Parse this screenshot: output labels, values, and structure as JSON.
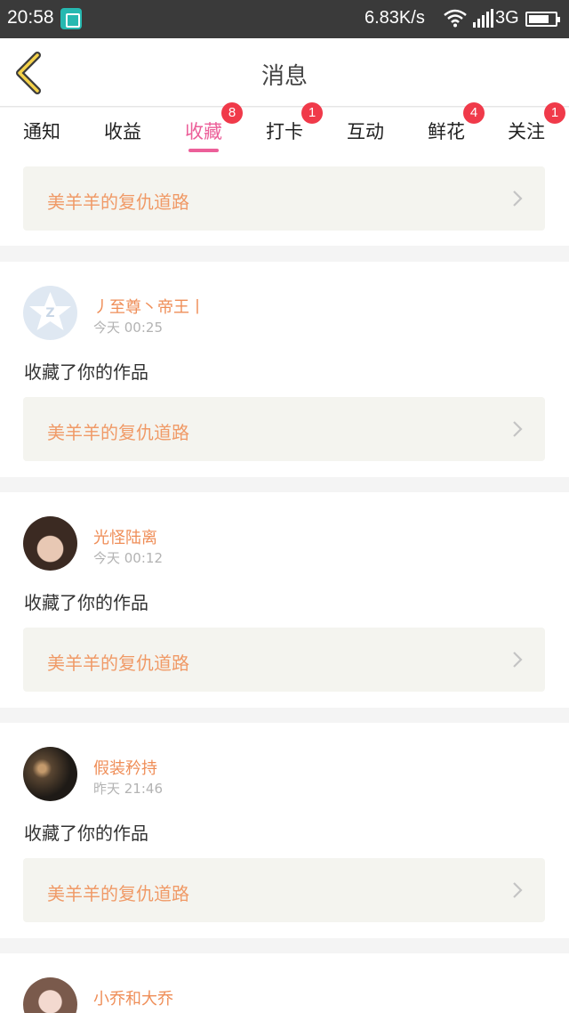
{
  "status_bar": {
    "time": "20:58",
    "net_speed": "6.83K/s",
    "network": "3G",
    "app_icon": "screenshot-icon"
  },
  "header": {
    "title": "消息",
    "back_icon": "chevron-left-icon"
  },
  "tabs": [
    {
      "label": "通知",
      "badge": ""
    },
    {
      "label": "收益",
      "badge": ""
    },
    {
      "label": "收藏",
      "badge": "8",
      "active": true
    },
    {
      "label": "打卡",
      "badge": "1"
    },
    {
      "label": "互动",
      "badge": ""
    },
    {
      "label": "鲜花",
      "badge": "4"
    },
    {
      "label": "关注",
      "badge": "1"
    }
  ],
  "first_card": {
    "work_title": "美羊羊的复仇道路"
  },
  "items": [
    {
      "user": "丿至尊丶帝王丨",
      "time": "今天 00:25",
      "action": "收藏了你的作品",
      "work_title": "美羊羊的复仇道路"
    },
    {
      "user": "光怪陆离",
      "time": "今天 00:12",
      "action": "收藏了你的作品",
      "work_title": "美羊羊的复仇道路"
    },
    {
      "user": "假装矜持",
      "time": "昨天 21:46",
      "action": "收藏了你的作品",
      "work_title": "美羊羊的复仇道路"
    },
    {
      "user": "小乔和大乔",
      "time": "",
      "action": "",
      "work_title": ""
    }
  ],
  "colors": {
    "accent": "#ec5f99",
    "username": "#ef8e58",
    "work_title": "#f09a67",
    "badge": "#f03a4a"
  }
}
